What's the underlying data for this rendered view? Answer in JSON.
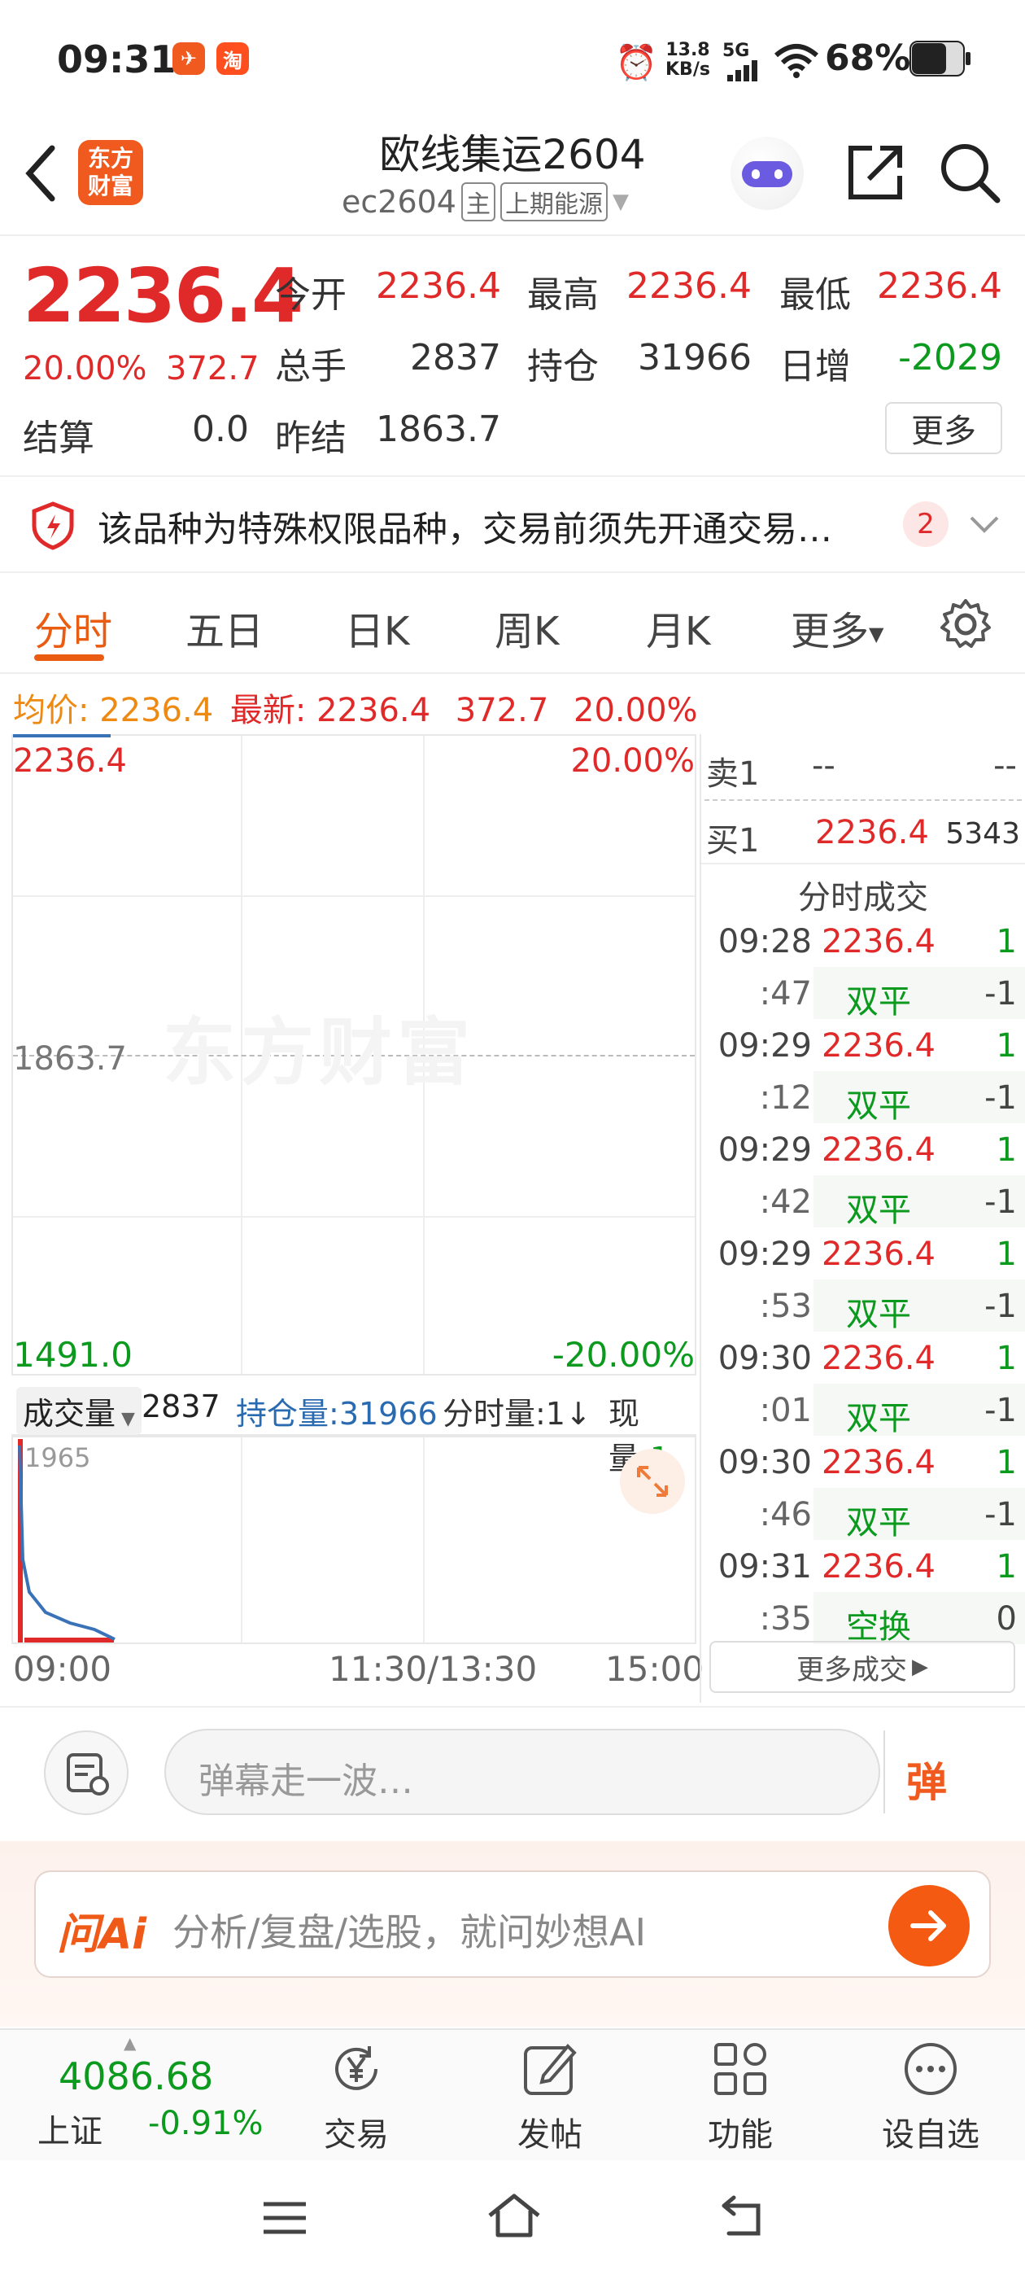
{
  "status_bar": {
    "time": "09:31",
    "net_speed_top": "13.8",
    "net_speed_bottom": "KB/s",
    "signal": "5G",
    "battery": "68%",
    "app_badge_taobao": "淘"
  },
  "header": {
    "brand_logo_line1": "东方",
    "brand_logo_line2": "财富",
    "title": "欧线集运2604",
    "code": "ec2604",
    "tag_main": "主",
    "tag_exchange": "上期能源"
  },
  "quote": {
    "price": "2236.4",
    "change_pct": "20.00%",
    "change_abs": "372.7",
    "open_label": "今开",
    "open": "2236.4",
    "high_label": "最高",
    "high": "2236.4",
    "low_label": "最低",
    "low": "2236.4",
    "volume_label": "总手",
    "volume": "2837",
    "oi_label": "持仓",
    "oi": "31966",
    "daily_inc_label": "日增",
    "daily_inc": "-2029",
    "settle_label": "结算",
    "settle": "0.0",
    "prev_settle_label": "昨结",
    "prev_settle": "1863.7",
    "more_label": "更多"
  },
  "notice": {
    "text": "该品种为特殊权限品种，交易前须先开通交易…",
    "count": "2"
  },
  "tabs": [
    "分时",
    "五日",
    "日K",
    "周K",
    "月K",
    "更多"
  ],
  "info_line": {
    "avg_label": "均价:",
    "avg": "2236.4",
    "latest_label": "最新:",
    "latest": "2236.4",
    "change": "372.7",
    "pct": "20.00%"
  },
  "chart": {
    "top_price": "2236.4",
    "top_pct": "20.00%",
    "mid_price": "1863.7",
    "bottom_price": "1491.0",
    "bottom_pct": "-20.00%",
    "watermark": "东方财富"
  },
  "volume_bar": {
    "selector": "成交量",
    "value": "2837",
    "oi_label": "持仓量:",
    "oi_value": "31966",
    "minute_vol": "分时量:1↓",
    "now_label": "现量:",
    "now_value": "1",
    "peak": "1965"
  },
  "time_axis": [
    "09:00",
    "11:30/13:30",
    "15:00"
  ],
  "order_book": {
    "sell_label": "卖1",
    "sell_price": "--",
    "sell_vol": "--",
    "buy_label": "买1",
    "buy_price": "2236.4",
    "buy_vol": "5343",
    "trades_title": "分时成交",
    "trades": [
      {
        "t": "09:28",
        "p": "2236.4",
        "v": "1"
      },
      {
        "t": ":47",
        "p": "双平",
        "v": "-1"
      },
      {
        "t": "09:29",
        "p": "2236.4",
        "v": "1"
      },
      {
        "t": ":12",
        "p": "双平",
        "v": "-1"
      },
      {
        "t": "09:29",
        "p": "2236.4",
        "v": "1"
      },
      {
        "t": ":42",
        "p": "双平",
        "v": "-1"
      },
      {
        "t": "09:29",
        "p": "2236.4",
        "v": "1"
      },
      {
        "t": ":53",
        "p": "双平",
        "v": "-1"
      },
      {
        "t": "09:30",
        "p": "2236.4",
        "v": "1"
      },
      {
        "t": ":01",
        "p": "双平",
        "v": "-1"
      },
      {
        "t": "09:30",
        "p": "2236.4",
        "v": "1"
      },
      {
        "t": ":46",
        "p": "双平",
        "v": "-1"
      },
      {
        "t": "09:31",
        "p": "2236.4",
        "v": "1"
      },
      {
        "t": ":35",
        "p": "空换",
        "v": "0"
      }
    ],
    "more_trades": "更多成交"
  },
  "danmaku": {
    "placeholder": "弹幕走一波…",
    "send_label": "弹"
  },
  "ai": {
    "brand": "问Ai",
    "placeholder": "分析/复盘/选股，就问妙想AI"
  },
  "bottom_nav": {
    "index_value": "4086.68",
    "index_name": "上证",
    "index_change": "-0.91%",
    "items": [
      "交易",
      "发帖",
      "功能",
      "设自选"
    ]
  }
}
